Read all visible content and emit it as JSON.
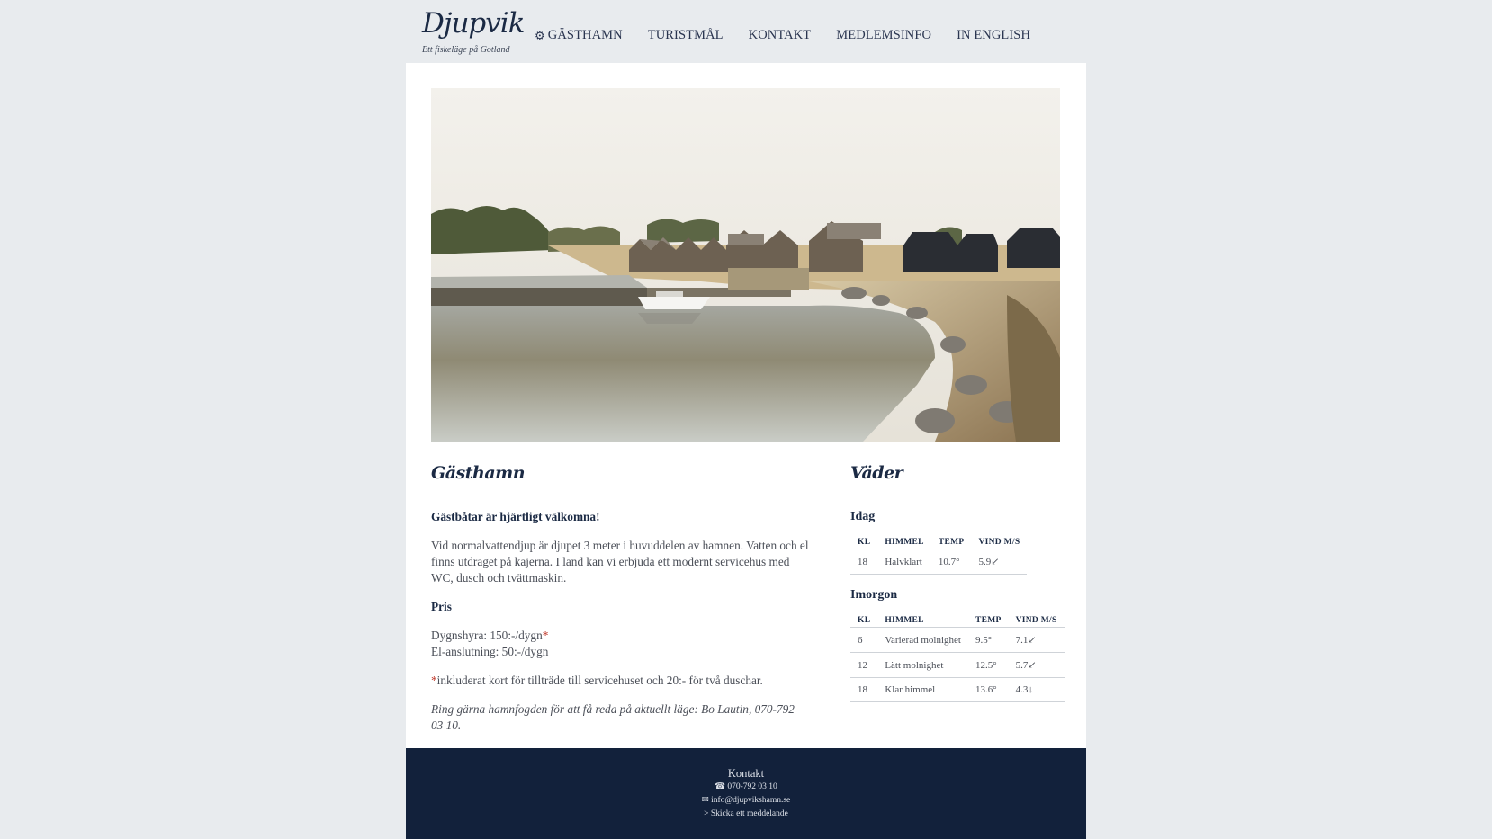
{
  "brand": {
    "title": "Djupvik",
    "subtitle": "Ett fiskeläge på Gotland"
  },
  "nav": {
    "items": [
      {
        "label": "GÄSTHAMN",
        "icon": "gear-icon"
      },
      {
        "label": "TURISTMÅL"
      },
      {
        "label": "KONTAKT"
      },
      {
        "label": "MEDLEMSINFO"
      },
      {
        "label": "IN ENGLISH"
      }
    ]
  },
  "main": {
    "title": "Gästhamn",
    "welcome": "Gästbåtar är hjärtligt välkomna!",
    "intro": "Vid normalvattendjup är djupet 3 meter i huvuddelen av hamnen. Vatten och el finns utdraget på kajerna. I land kan vi erbjuda ett modernt servicehus med WC, dusch och tvättmaskin.",
    "price_heading": "Pris",
    "price_line1": "Dygnshyra: 150:-/dygn",
    "price_line1_mark": "*",
    "price_line2": "El-anslutning: 50:-/dygn",
    "footnote_mark": "*",
    "footnote": "inkluderat kort för tillträde till servicehuset och 20:- för två duschar.",
    "contact_note": "Ring gärna hamnfogden för att få reda på aktuellt läge:  Bo Lautin, 070-792 03 10."
  },
  "weather": {
    "title": "Väder",
    "headers": [
      "KL",
      "HIMMEL",
      "TEMP",
      "VIND M/S"
    ],
    "today": {
      "label": "Idag",
      "rows": [
        {
          "kl": "18",
          "sky": "Halvklart",
          "temp": "10.7°",
          "wind": "5.9",
          "arrow": "↙"
        }
      ]
    },
    "tomorrow": {
      "label": "Imorgon",
      "rows": [
        {
          "kl": "6",
          "sky": "Varierad molnighet",
          "temp": "9.5°",
          "wind": "7.1",
          "arrow": "↙"
        },
        {
          "kl": "12",
          "sky": "Lätt molnighet",
          "temp": "12.5°",
          "wind": "5.7",
          "arrow": "↙"
        },
        {
          "kl": "18",
          "sky": "Klar himmel",
          "temp": "13.6°",
          "wind": "4.3",
          "arrow": "↓"
        }
      ]
    }
  },
  "footer": {
    "title": "Kontakt",
    "phone_icon": "☎",
    "phone": "070-792 03 10",
    "email_icon": "✉",
    "email": "info@djupvikshamn.se",
    "message_prefix": ">",
    "message": "Skicka ett meddelande"
  },
  "colors": {
    "navy": "#12213b",
    "background": "#e8ebee",
    "accent_red": "#c0392b"
  }
}
